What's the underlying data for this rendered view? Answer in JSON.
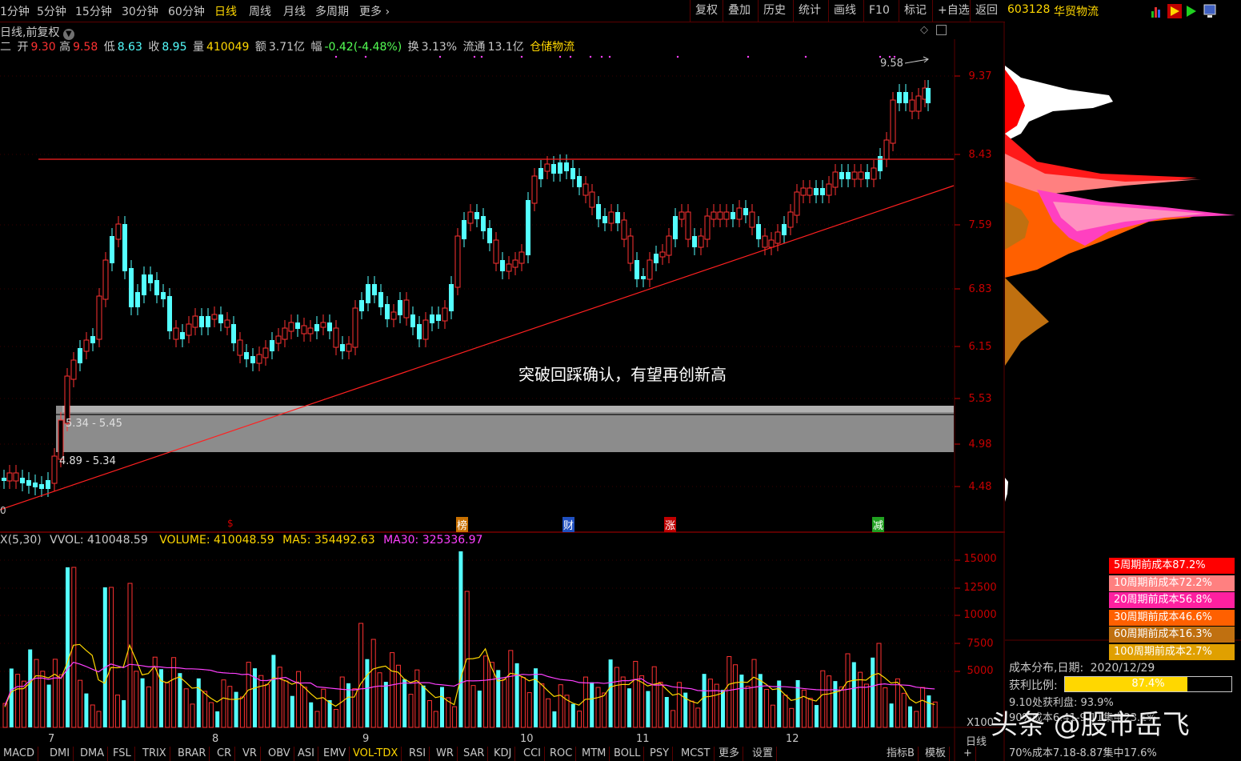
{
  "toolbar": {
    "periods": [
      "1分钟",
      "5分钟",
      "15分钟",
      "30分钟",
      "60分钟",
      "日线",
      "周线",
      "月线",
      "多周期",
      "更多"
    ],
    "active_period": "日线",
    "buttons": [
      "复权",
      "叠加",
      "历史",
      "统计",
      "画线",
      "F10",
      "标记",
      "+自选",
      "返回"
    ]
  },
  "stock": {
    "code": "603128",
    "name": "华贸物流"
  },
  "chart_header": {
    "mode": "日线,前复权",
    "day_prefix": "二",
    "open_label": "开",
    "open": "9.30",
    "high_label": "高",
    "high": "9.58",
    "low_label": "低",
    "low": "8.63",
    "close_label": "收",
    "close": "8.95",
    "vol_label": "量",
    "vol": "410049",
    "amount_label": "额",
    "amount": "3.71亿",
    "change_label": "幅",
    "change": "-0.42(-4.48%)",
    "turnover_label": "换",
    "turnover": "3.13%",
    "float_label": "流通",
    "float": "13.1亿",
    "sector": "仓储物流"
  },
  "price_axis": [
    "9.37",
    "8.43",
    "7.59",
    "6.83",
    "6.15",
    "5.53",
    "4.98",
    "4.48"
  ],
  "annotations": {
    "max_price": "9.58",
    "zone_upper": "5.34 - 5.45",
    "zone_lower": "4.89 - 5.34",
    "comment": "突破回踩确认，有望再创新高",
    "left_zero": "0"
  },
  "event_markers": [
    {
      "text": "$",
      "color": "#d00000"
    },
    {
      "text": "榜",
      "color": "#c87000"
    },
    {
      "text": "财",
      "color": "#2050c0"
    },
    {
      "text": "涨",
      "color": "#c00000"
    },
    {
      "text": "减",
      "color": "#20a020"
    }
  ],
  "volume_header": {
    "prefix": "X(5,30)",
    "vvol": "VVOL: 410048.59",
    "volume": "VOLUME: 410048.59",
    "ma5": "MA5: 354492.63",
    "ma30": "MA30: 325336.97"
  },
  "volume_axis": [
    "15000",
    "12500",
    "10000",
    "7500",
    "5000"
  ],
  "volume_unit": "X100",
  "month_labels": [
    "7",
    "8",
    "9",
    "10",
    "11",
    "12"
  ],
  "bottom_tabs": [
    "MACD",
    "DMI",
    "DMA",
    "FSL",
    "TRIX",
    "BRAR",
    "CR",
    "VR",
    "OBV",
    "ASI",
    "EMV",
    "VOL-TDX",
    "RSI",
    "WR",
    "SAR",
    "KDJ",
    "CCI",
    "ROC",
    "MTM",
    "BOLL",
    "PSY",
    "MCST",
    "更多",
    "设置"
  ],
  "active_tab": "VOL-TDX",
  "bottom_right": [
    "指标B",
    "模板",
    "+"
  ],
  "cost_legend": [
    {
      "label": "5周期前成本87.2%",
      "color": "#ff0000"
    },
    {
      "label": "10周期前成本72.2%",
      "color": "#ff8080"
    },
    {
      "label": "20周期前成本56.8%",
      "color": "#ff20a0"
    },
    {
      "label": "30周期前成本46.6%",
      "color": "#ff6000"
    },
    {
      "label": "60周期前成本16.3%",
      "color": "#c07010"
    },
    {
      "label": "100周期前成本2.7%",
      "color": "#e0a000"
    }
  ],
  "cost_info": {
    "title": "成本分布,日期:",
    "date": "2020/12/29",
    "profit_label": "获利比例:",
    "profit_value": "87.4%",
    "profit_fraction": 0.874,
    "line3": "9.10处获利盘: 93.9%",
    "line4": "90%成本6.41-9.11集中23.1%",
    "line5": "70%成本7.18-8.87集中17.6%",
    "period_label": "日线"
  },
  "watermark": "头条 @股市岳飞",
  "colors": {
    "up": "#ff3232",
    "down": "#54ffff",
    "ma5": "#ffd700",
    "ma30": "#ff40ff",
    "grid": "#5a0000",
    "axis": "#c80000"
  }
}
